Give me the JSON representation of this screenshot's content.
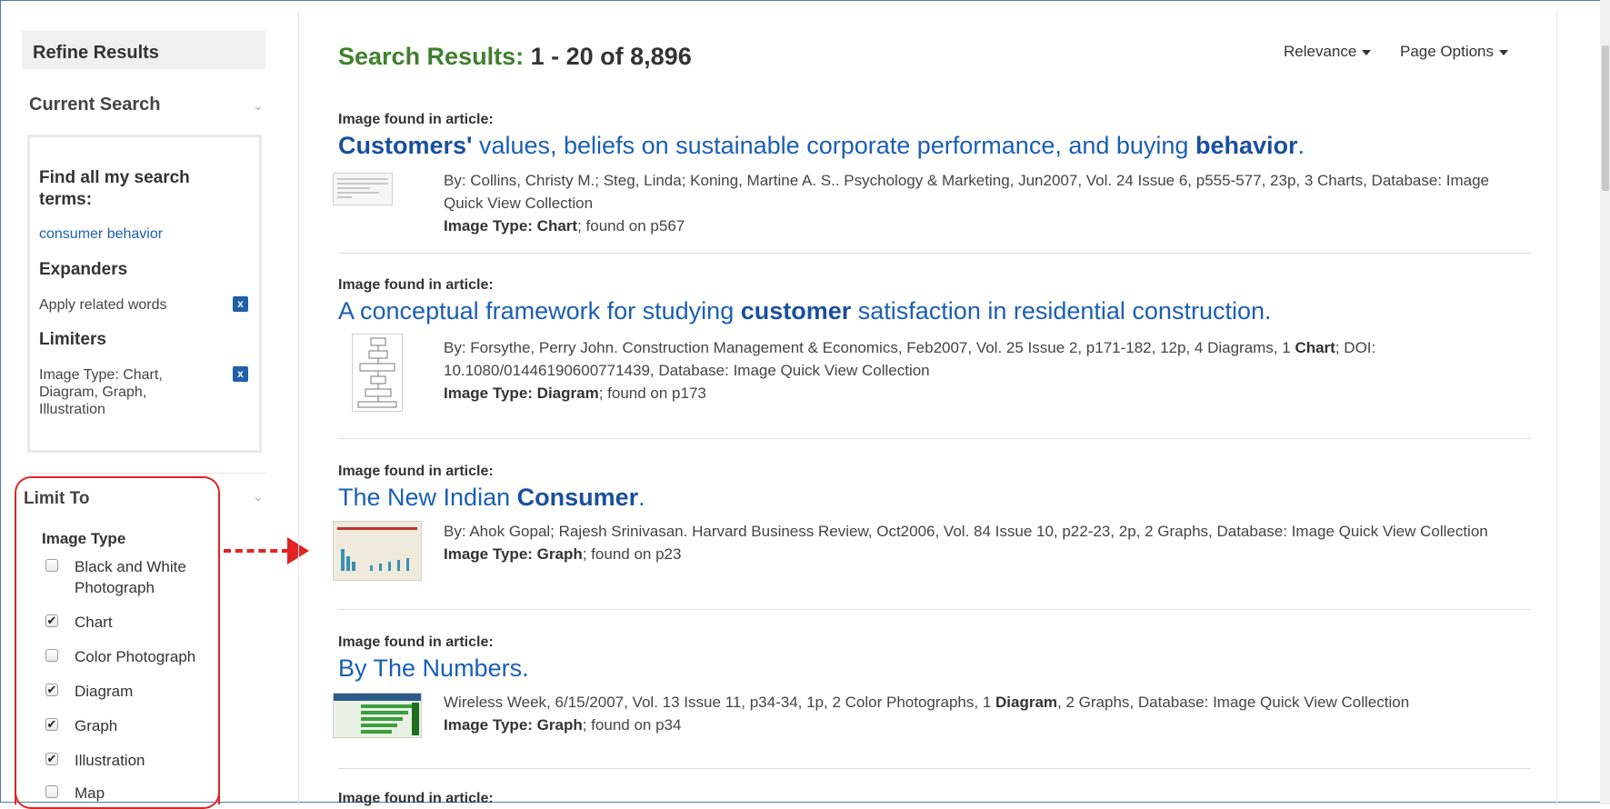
{
  "sidebar": {
    "refine_title": "Refine Results",
    "current_search": {
      "heading": "Current Search",
      "find_label": "Find all my search terms:",
      "find_label_line1": "Find all my search",
      "find_label_line2": "terms:",
      "term": "consumer behavior",
      "expanders_heading": "Expanders",
      "expander_item": "Apply related words",
      "limiters_heading": "Limiters",
      "limiter_line1": "Image Type: Chart,",
      "limiter_line2": "Diagram, Graph,",
      "limiter_line3": "Illustration",
      "remove_symbol": "x"
    },
    "limit_to": {
      "heading": "Limit To",
      "group_label": "Image Type",
      "options": [
        {
          "label_line1": "Black and White",
          "label_line2": "Photograph",
          "checked": false
        },
        {
          "label_line1": "Chart",
          "label_line2": "",
          "checked": true
        },
        {
          "label_line1": "Color Photograph",
          "label_line2": "",
          "checked": false
        },
        {
          "label_line1": "Diagram",
          "label_line2": "",
          "checked": true
        },
        {
          "label_line1": "Graph",
          "label_line2": "",
          "checked": true
        },
        {
          "label_line1": "Illustration",
          "label_line2": "",
          "checked": true
        },
        {
          "label_line1": "Map",
          "label_line2": "",
          "checked": false
        }
      ]
    }
  },
  "header": {
    "results_label": "Search Results:",
    "results_count": "1 - 20 of 8,896",
    "sort_label": "Relevance",
    "page_options_label": "Page Options"
  },
  "results": [
    {
      "found_label": "Image found in article:",
      "title_parts": [
        {
          "text": "Customers'",
          "bold": true
        },
        {
          "text": " values, beliefs on sustainable corporate performance, and buying ",
          "bold": false
        },
        {
          "text": "behavior",
          "bold": true
        },
        {
          "text": ".",
          "bold": false
        }
      ],
      "meta_line1": "By: Collins, Christy M.; Steg, Linda; Koning, Martine A. S.. Psychology & Marketing, Jun2007, Vol. 24 Issue 6, p555-577, 23p, 3 Charts, Database: Image",
      "meta_line2": "Quick View Collection",
      "type_label": "Image Type:",
      "type_value": "Chart",
      "found_on": "; found on p567"
    },
    {
      "found_label": "Image found in article:",
      "title_parts": [
        {
          "text": "A conceptual framework for studying ",
          "bold": false
        },
        {
          "text": "customer",
          "bold": true
        },
        {
          "text": " satisfaction in residential construction.",
          "bold": false
        }
      ],
      "meta_line1_a": "By: Forsythe, Perry John. Construction Management & Economics, Feb2007, Vol. 25 Issue 2, p171-182, 12p, 4 Diagrams, 1 ",
      "meta_line1_b": "Chart",
      "meta_line1_c": "; DOI:",
      "meta_line2": "10.1080/01446190600771439, Database: Image Quick View Collection",
      "type_label": "Image Type:",
      "type_value": "Diagram",
      "found_on": "; found on p173"
    },
    {
      "found_label": "Image found in article:",
      "title_parts": [
        {
          "text": "The New Indian ",
          "bold": false
        },
        {
          "text": "Consumer",
          "bold": true
        },
        {
          "text": ".",
          "bold": false
        }
      ],
      "meta_line1": "By: Ahok Gopal; Rajesh Srinivasan. Harvard Business Review, Oct2006, Vol. 84 Issue 10, p22-23, 2p, 2 Graphs, Database: Image Quick View Collection",
      "type_label": "Image Type:",
      "type_value": "Graph",
      "found_on": "; found on p23"
    },
    {
      "found_label": "Image found in article:",
      "title_parts": [
        {
          "text": "By The Numbers.",
          "bold": false
        }
      ],
      "meta_line1_a": "Wireless Week, 6/15/2007, Vol. 13 Issue 11, p34-34, 1p, 2 Color Photographs, 1 ",
      "meta_line1_b": "Diagram",
      "meta_line1_c": ", 2 Graphs, Database: Image Quick View Collection",
      "type_label": "Image Type:",
      "type_value": "Graph",
      "found_on": "; found on p34"
    },
    {
      "found_label": "Image found in article:"
    }
  ],
  "colors": {
    "link": "#1a5fb4",
    "results_green": "#3f7f2e",
    "annotation_red": "#e02424",
    "remove_button": "#1f5fa8"
  },
  "icons": {
    "chevron": "chevron-down-icon",
    "remove": "remove-x-icon",
    "checkbox": "checkbox-icon",
    "annotation_arrow": "red-dashed-arrow"
  }
}
